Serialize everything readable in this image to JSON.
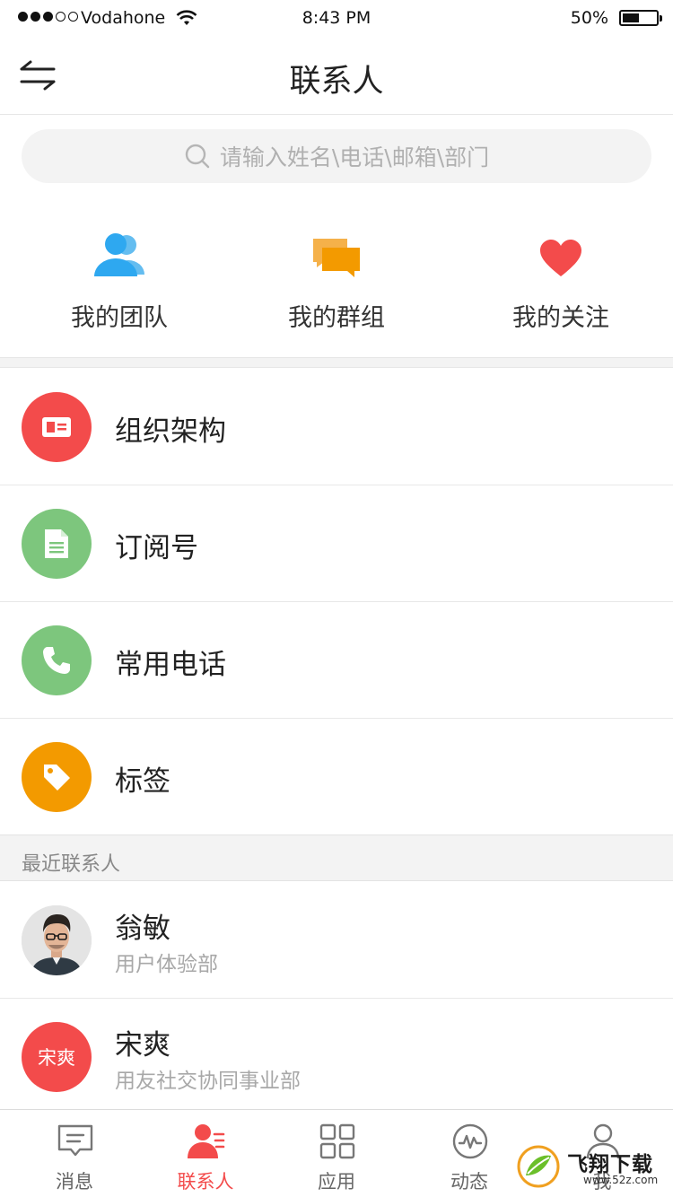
{
  "status_bar": {
    "carrier": "Vodahone",
    "time": "8:43 PM",
    "battery": "50%",
    "battery_level": 0.5
  },
  "nav": {
    "title": "联系人",
    "switch_icon": "swap-arrows-icon"
  },
  "search": {
    "placeholder": "请输入姓名\\电话\\邮箱\\部门"
  },
  "quick_actions": [
    {
      "label": "我的团队",
      "icon": "team-icon",
      "color": "#2ea8f0"
    },
    {
      "label": "我的群组",
      "icon": "group-chat-icon",
      "color": "#f39a00"
    },
    {
      "label": "我的关注",
      "icon": "heart-icon",
      "color": "#f34b4b"
    }
  ],
  "menu": [
    {
      "label": "组织架构",
      "icon": "id-card-icon",
      "color": "#f34b4b"
    },
    {
      "label": "订阅号",
      "icon": "document-icon",
      "color": "#7dc67d"
    },
    {
      "label": "常用电话",
      "icon": "phone-icon",
      "color": "#7dc67d"
    },
    {
      "label": "标签",
      "icon": "tag-icon",
      "color": "#f39a00"
    }
  ],
  "recent": {
    "header": "最近联系人",
    "contacts": [
      {
        "name": "翁敏",
        "dept": "用户体验部",
        "avatar": "photo"
      },
      {
        "name": "宋爽",
        "dept": "用友社交协同事业部",
        "avatar_text": "宋爽",
        "avatar_color": "#f34b4b"
      }
    ]
  },
  "tabs": [
    {
      "label": "消息",
      "icon": "message-icon",
      "active": false
    },
    {
      "label": "联系人",
      "icon": "contacts-icon",
      "active": true
    },
    {
      "label": "应用",
      "icon": "apps-grid-icon",
      "active": false
    },
    {
      "label": "动态",
      "icon": "activity-icon",
      "active": false
    },
    {
      "label": "我",
      "icon": "profile-icon",
      "active": false
    }
  ],
  "watermark": {
    "text": "飞翔下载",
    "sub": "www.52z.com"
  },
  "colors": {
    "accent": "#f34b4b",
    "divider": "#e8e8e8"
  }
}
